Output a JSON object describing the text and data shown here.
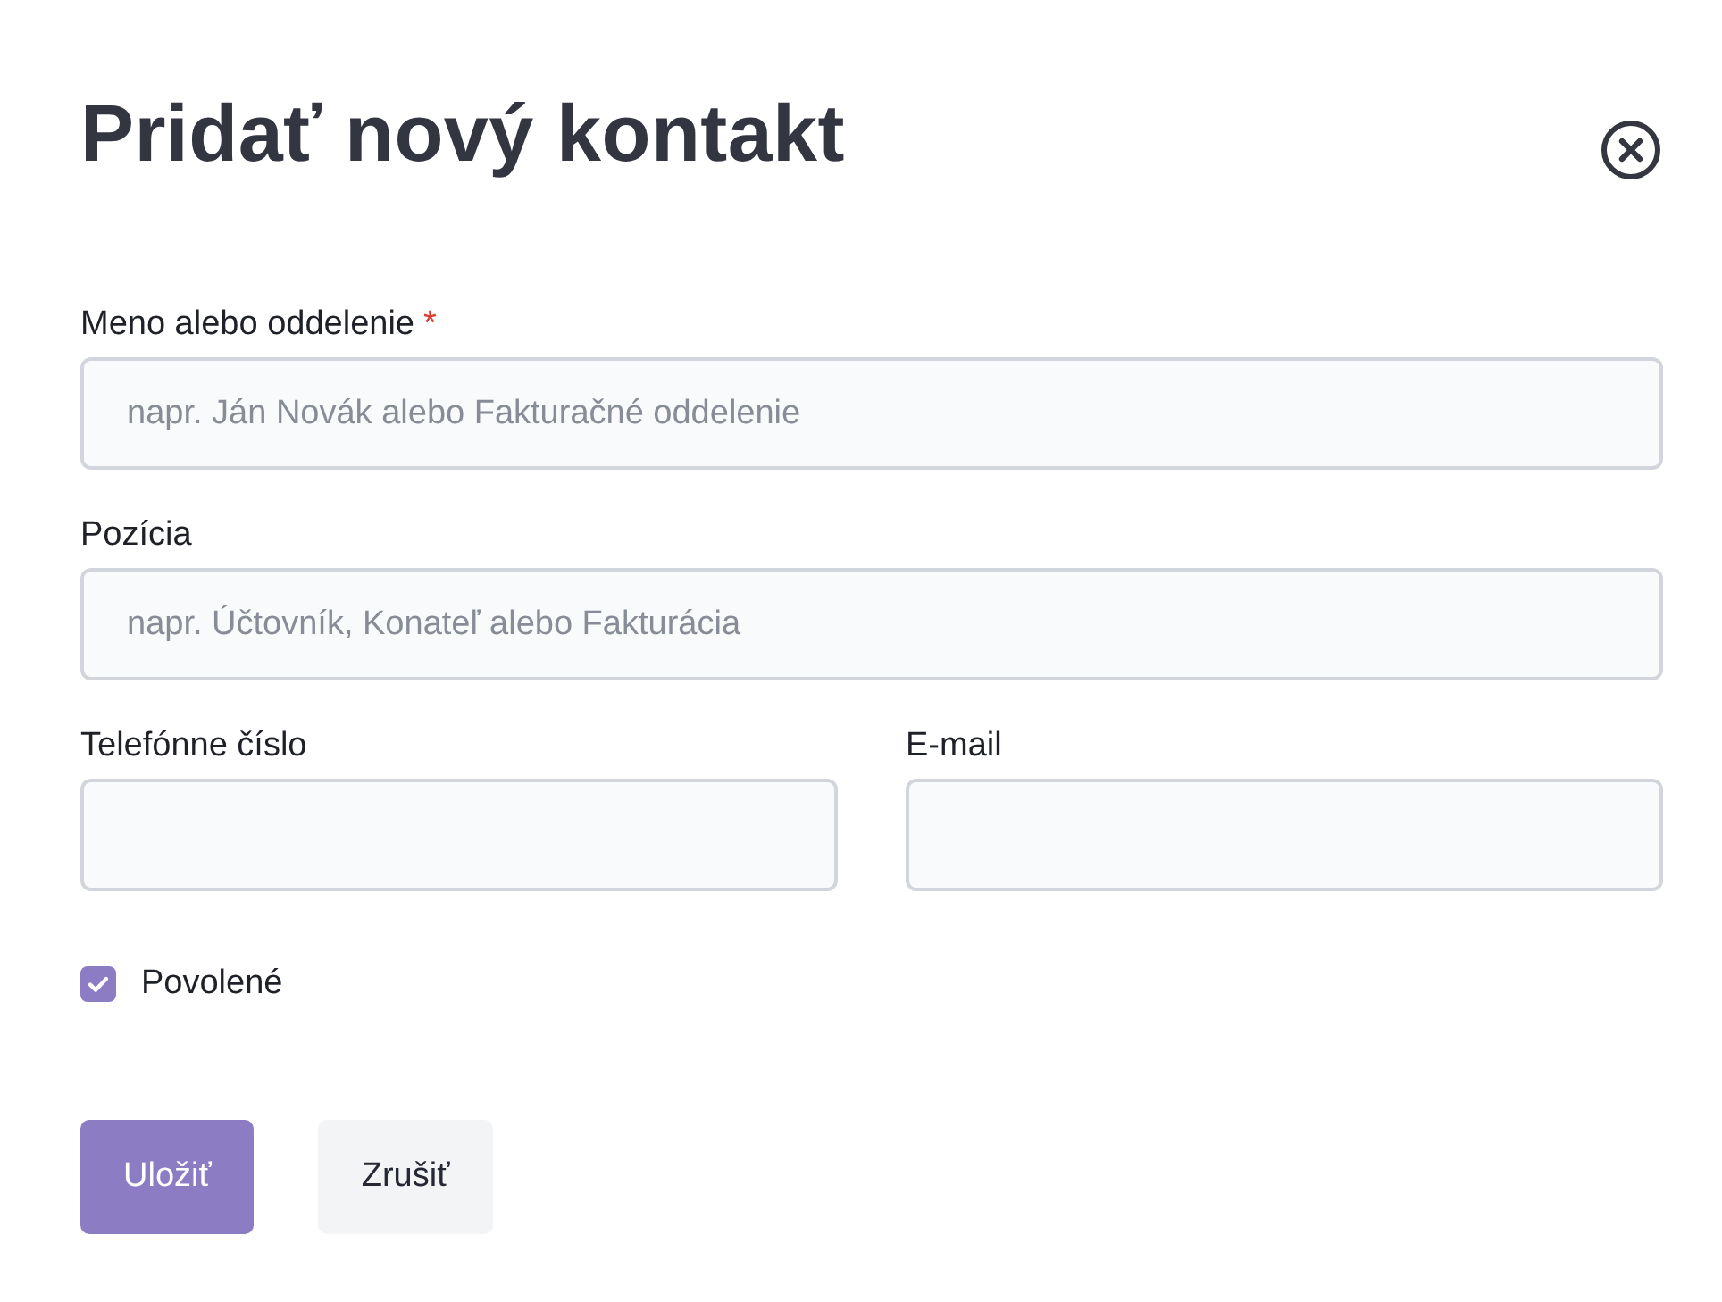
{
  "dialog": {
    "title": "Pridať nový kontakt"
  },
  "form_rows": [
    {
      "fields": [
        {
          "label": "Meno alebo oddelenie",
          "required_mark": "*",
          "placeholder": "napr. Ján Novák alebo Fakturačné oddelenie"
        }
      ]
    },
    {
      "fields": [
        {
          "label": "Pozícia",
          "placeholder": "napr. Účtovník, Konateľ alebo Fakturácia"
        }
      ]
    },
    {
      "fields": [
        {
          "label": "Telefónne číslo"
        },
        {
          "label": "E-mail"
        }
      ]
    }
  ],
  "checkbox": {
    "label": "Povolené",
    "checked": true
  },
  "buttons": [
    {
      "label": "Uložiť",
      "kind": "primary"
    },
    {
      "label": "Zrušiť",
      "kind": "secondary"
    }
  ]
}
